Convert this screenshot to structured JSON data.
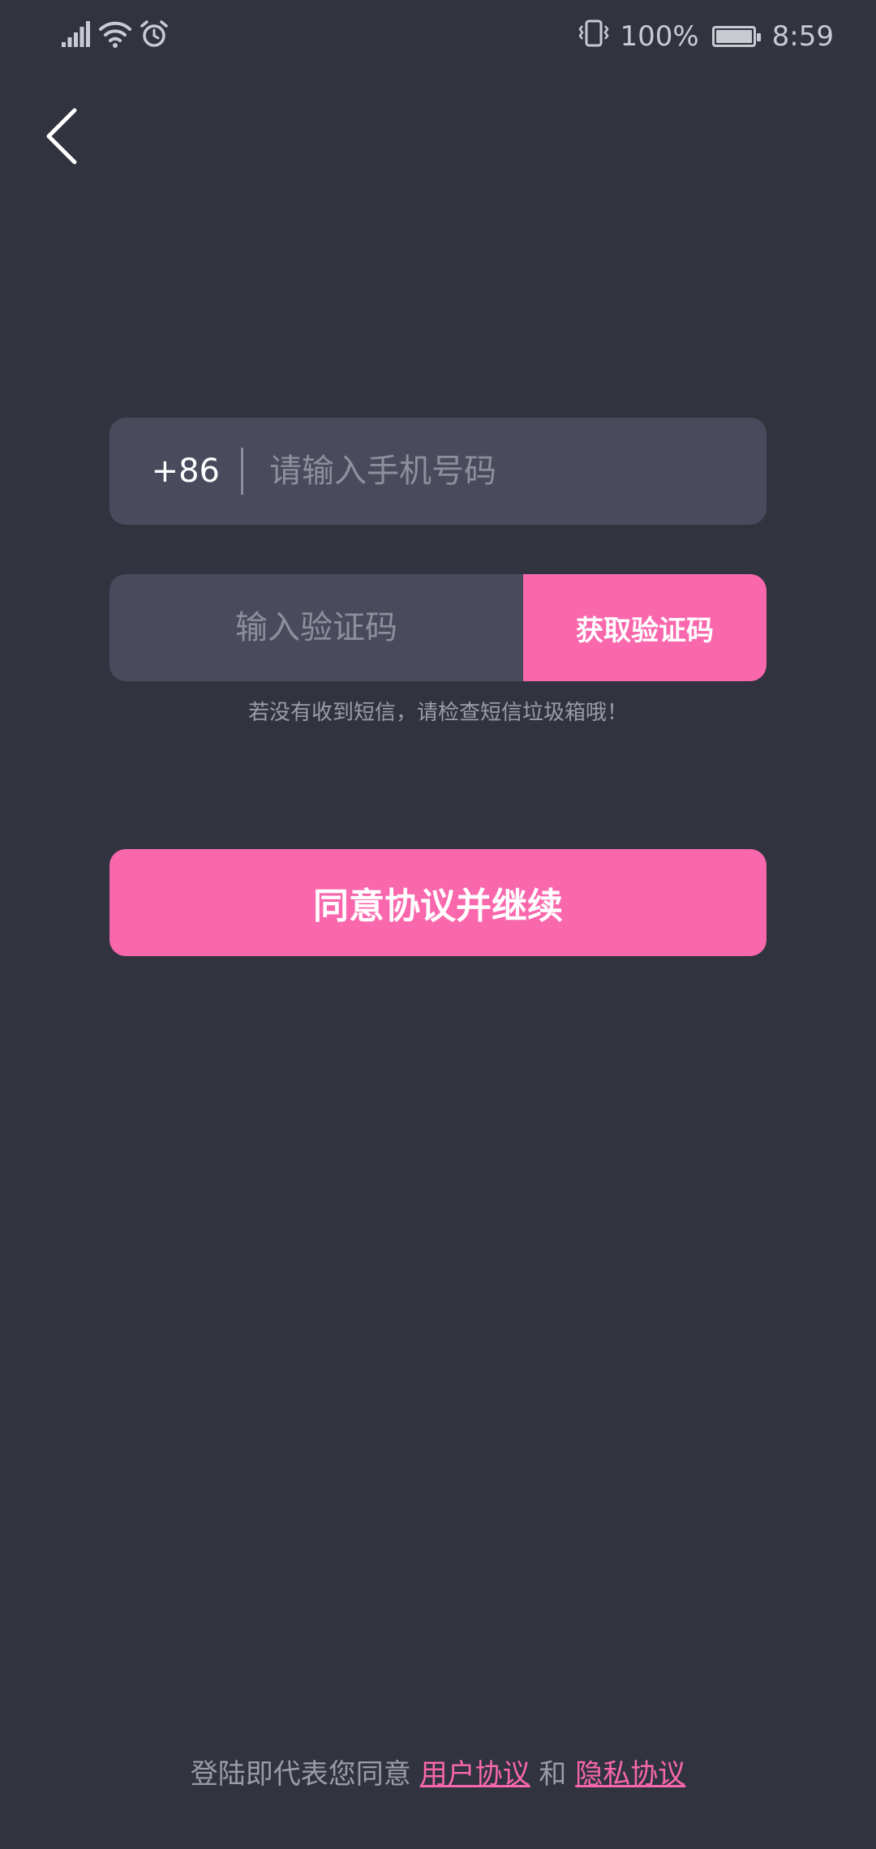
{
  "status_bar": {
    "battery_percent": "100%",
    "battery_level": 1.0,
    "time": "8:59",
    "icons": [
      "signal-icon",
      "wifi-icon",
      "alarm-icon",
      "vibrate-icon",
      "battery-icon"
    ]
  },
  "nav": {
    "back_icon": "chevron-left-icon"
  },
  "phone": {
    "country_code": "+86",
    "placeholder": "请输入手机号码",
    "value": ""
  },
  "verification": {
    "placeholder": "输入验证码",
    "value": "",
    "get_code_label": "获取验证码",
    "hint": "若没有收到短信，请检查短信垃圾箱哦！"
  },
  "actions": {
    "continue_label": "同意协议并继续"
  },
  "footer": {
    "prefix": "登陆即代表您同意 ",
    "user_agreement": "用户协议",
    "conjunction": " 和 ",
    "privacy_agreement": "隐私协议"
  },
  "colors": {
    "background": "#31333F",
    "field": "#494B5D",
    "accent": "#F967AC",
    "muted_text": "#9A9CA8"
  }
}
